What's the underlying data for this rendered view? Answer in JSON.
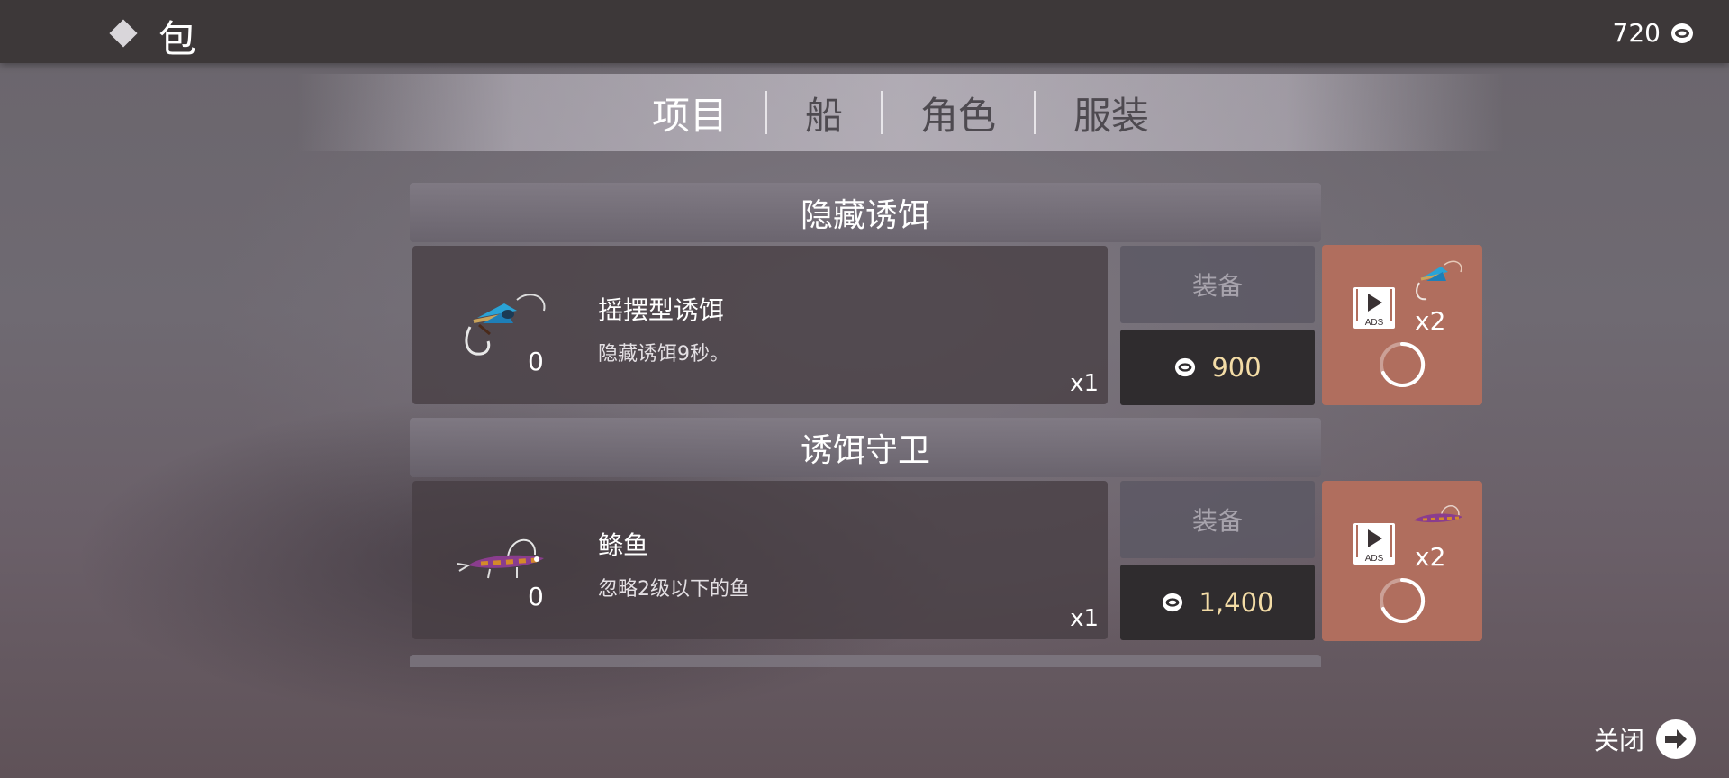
{
  "header": {
    "title": "包",
    "currency_amount": "720"
  },
  "tabs": [
    {
      "label": "项目",
      "active": true
    },
    {
      "label": "船",
      "active": false
    },
    {
      "label": "角色",
      "active": false
    },
    {
      "label": "服装",
      "active": false
    }
  ],
  "sections": [
    {
      "title": "隐藏诱饵",
      "item": {
        "name": "摇摆型诱饵",
        "description": "隐藏诱饵9秒。",
        "owned": "0",
        "quantity": "x1",
        "icon": "fly-lure-icon"
      },
      "equip_label": "装备",
      "price": "900",
      "ad_reward": {
        "multiplier": "x2",
        "ads_label": "ADS"
      }
    },
    {
      "title": "诱饵守卫",
      "item": {
        "name": "鲦鱼",
        "description": "忽略2级以下的鱼",
        "owned": "0",
        "quantity": "x1",
        "icon": "minnow-lure-icon"
      },
      "equip_label": "装备",
      "price": "1,400",
      "ad_reward": {
        "multiplier": "x2",
        "ads_label": "ADS"
      }
    }
  ],
  "footer": {
    "close_label": "关闭"
  },
  "colors": {
    "topbar": "#3d3839",
    "ad_card": "#b06e5e",
    "price_text": "#f3dca6",
    "equip_text": "#a7a3ac"
  }
}
